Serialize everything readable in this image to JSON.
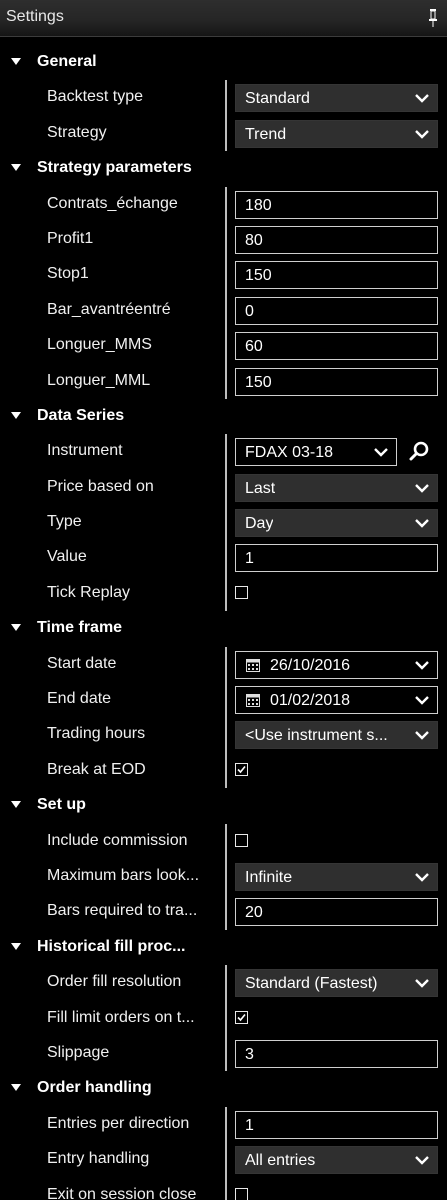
{
  "window": {
    "title": "Settings"
  },
  "rows": [
    {
      "kind": "category",
      "label": "General"
    },
    {
      "kind": "prop",
      "label": "Backtest type",
      "control": "dropdown",
      "value": "Standard"
    },
    {
      "kind": "prop",
      "label": "Strategy",
      "control": "dropdown",
      "value": "Trend"
    },
    {
      "kind": "category",
      "label": "Strategy parameters"
    },
    {
      "kind": "prop",
      "label": "Contrats_échange",
      "control": "input",
      "value": "180"
    },
    {
      "kind": "prop",
      "label": "Profit1",
      "control": "input",
      "value": "80"
    },
    {
      "kind": "prop",
      "label": "Stop1",
      "control": "input",
      "value": "150"
    },
    {
      "kind": "prop",
      "label": "Bar_avantréentré",
      "control": "input",
      "value": "0"
    },
    {
      "kind": "prop",
      "label": "Longuer_MMS",
      "control": "input",
      "value": "60"
    },
    {
      "kind": "prop",
      "label": "Longuer_MML",
      "control": "input",
      "value": "150"
    },
    {
      "kind": "category",
      "label": "Data Series"
    },
    {
      "kind": "prop",
      "label": "Instrument",
      "control": "instrument",
      "value": "FDAX 03-18"
    },
    {
      "kind": "prop",
      "label": "Price based on",
      "control": "dropdown",
      "value": "Last"
    },
    {
      "kind": "prop",
      "label": "Type",
      "control": "dropdown",
      "value": "Day"
    },
    {
      "kind": "prop",
      "label": "Value",
      "control": "input",
      "value": "1"
    },
    {
      "kind": "prop",
      "label": "Tick Replay",
      "control": "checkbox",
      "checked": false
    },
    {
      "kind": "category",
      "label": "Time frame"
    },
    {
      "kind": "prop",
      "label": "Start date",
      "control": "date",
      "value": "26/10/2016"
    },
    {
      "kind": "prop",
      "label": "End date",
      "control": "date",
      "value": "01/02/2018"
    },
    {
      "kind": "prop",
      "label": "Trading hours",
      "control": "dropdown",
      "value": "<Use instrument s..."
    },
    {
      "kind": "prop",
      "label": "Break at EOD",
      "control": "checkbox",
      "checked": true
    },
    {
      "kind": "category",
      "label": "Set up"
    },
    {
      "kind": "prop",
      "label": "Include commission",
      "control": "checkbox",
      "checked": false
    },
    {
      "kind": "prop",
      "label": "Maximum bars look...",
      "control": "dropdown",
      "value": "Infinite"
    },
    {
      "kind": "prop",
      "label": "Bars required to tra...",
      "control": "input",
      "value": "20"
    },
    {
      "kind": "category",
      "label": "Historical fill proc..."
    },
    {
      "kind": "prop",
      "label": "Order fill resolution",
      "control": "dropdown",
      "value": "Standard (Fastest)"
    },
    {
      "kind": "prop",
      "label": "Fill limit orders on t...",
      "control": "checkbox",
      "checked": true
    },
    {
      "kind": "prop",
      "label": "Slippage",
      "control": "input",
      "value": "3"
    },
    {
      "kind": "category",
      "label": "Order handling"
    },
    {
      "kind": "prop",
      "label": "Entries per direction",
      "control": "input",
      "value": "1"
    },
    {
      "kind": "prop",
      "label": "Entry handling",
      "control": "dropdown",
      "value": "All entries"
    },
    {
      "kind": "prop",
      "label": "Exit on session close",
      "control": "checkbox",
      "checked": false
    }
  ],
  "icons": {
    "category_arrow": "caret-down-icon",
    "dropdown": "chevron-down-icon",
    "date": "calendar-icon",
    "search": "search-icon",
    "pin": "pin-icon",
    "check": "checkmark-icon"
  },
  "colors": {
    "background": "#000000",
    "text": "#ffffff",
    "dropdown_bg": "#2f2f2f",
    "input_border": "#cfcfcf",
    "divider": "#bdbdbd"
  }
}
